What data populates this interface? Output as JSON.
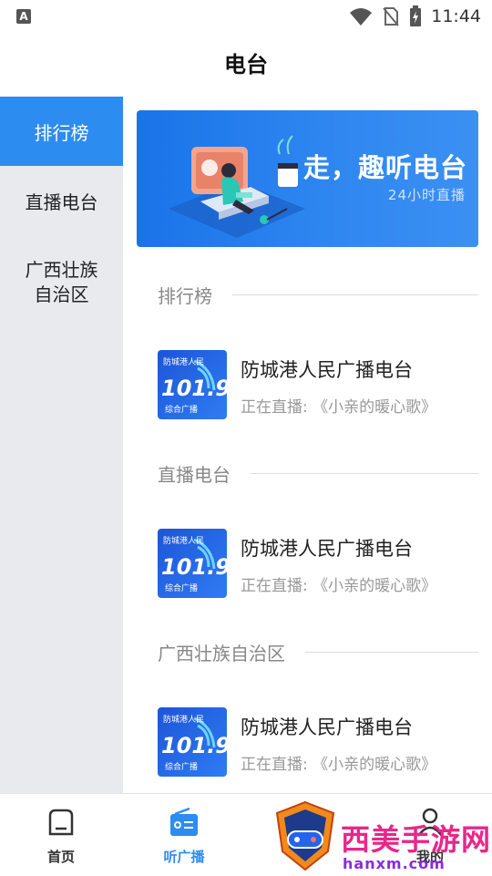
{
  "status_bar": {
    "app_icon_letter": "A",
    "time": "11:44",
    "icons": [
      "wifi-icon",
      "no-sim-icon",
      "battery-charging-icon"
    ]
  },
  "header": {
    "title": "电台"
  },
  "sidebar": {
    "items": [
      {
        "label": "排行榜",
        "active": true
      },
      {
        "label": "直播电台",
        "active": false
      },
      {
        "label": "广西壮族自治区",
        "active": false
      }
    ]
  },
  "banner": {
    "title": "走，趣听电台",
    "subtitle": "24小时直播",
    "illustration": "person-listening-illustration"
  },
  "sections": [
    {
      "label": "排行榜",
      "station": {
        "name": "防城港人民广播电台",
        "status": "正在直播: 《小亲的暖心歌》"
      }
    },
    {
      "label": "直播电台",
      "station": {
        "name": "防城港人民广播电台",
        "status": "正在直播: 《小亲的暖心歌》"
      }
    },
    {
      "label": "广西壮族自治区",
      "station": {
        "name": "防城港人民广播电台",
        "status": "正在直播: 《小亲的暖心歌》"
      }
    }
  ],
  "station_logo": {
    "top_text": "防城港人民",
    "freq": "101.9",
    "sub": "综合广播"
  },
  "bottom_nav": {
    "items": [
      {
        "label": "首页",
        "icon": "home-icon",
        "active": false
      },
      {
        "label": "听广播",
        "icon": "radio-icon",
        "active": true
      },
      {
        "label": "",
        "icon": "tv-icon",
        "active": false
      },
      {
        "label": "我的",
        "icon": "user-icon",
        "active": false
      }
    ]
  },
  "watermark": {
    "text": "西美手游网",
    "url": "hanxm.com"
  },
  "colors": {
    "accent": "#2d8cf0",
    "sidebar_bg": "#e9eaee",
    "watermark": "#e8278a"
  }
}
